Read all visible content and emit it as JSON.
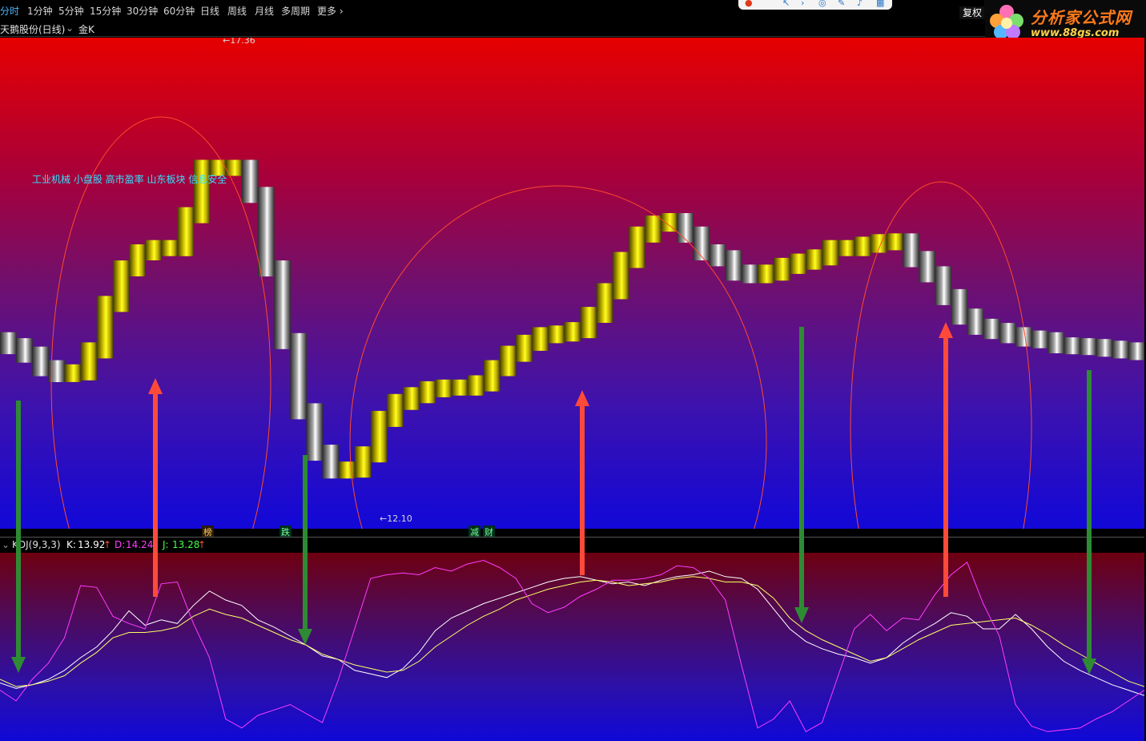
{
  "periods": [
    "分时",
    "1分钟",
    "5分钟",
    "15分钟",
    "30分钟",
    "60分钟",
    "日线",
    "周线",
    "月线",
    "多周期",
    "更多"
  ],
  "fuquan": "复权",
  "logo": {
    "name": "分析家公式网",
    "url": "www.88gs.com"
  },
  "title": {
    "stock": "天鹅股份(日线)",
    "indicator": "金K"
  },
  "tags": "工业机械 小盘股 高市盈率 山东板块 信息安全",
  "price": {
    "high_label": "←17.36",
    "low_label": "←12.10"
  },
  "signals": [
    "榜",
    "跌",
    "减",
    "财"
  ],
  "kdj": {
    "name": "KDJ(9,3,3)",
    "k_label": "K:",
    "k": "13.92",
    "d_label": "D:",
    "d": "14.24",
    "j_label": "J:",
    "j": "13.28"
  },
  "colors": {
    "k": "#ffffff",
    "d": "#ffff66",
    "j": "#ff3cff",
    "up": "#ff4a3a",
    "down": "#2e8b34",
    "circle": "#ff4a2a",
    "candle": "#f2e500"
  },
  "chart_data": [
    {
      "type": "line",
      "x": [
        1,
        2,
        3,
        4,
        5,
        6,
        7,
        8,
        9,
        10,
        11,
        12,
        13,
        14,
        15,
        16,
        17,
        18,
        19,
        20,
        21,
        22,
        23,
        24,
        25,
        26,
        27,
        28,
        29,
        30,
        31,
        32,
        33,
        34,
        35,
        36,
        37,
        38,
        39,
        40,
        41,
        42,
        43,
        44,
        45,
        46,
        47,
        48,
        49,
        50,
        51,
        52,
        53,
        54,
        55,
        56,
        57,
        58,
        59,
        60,
        61,
        62,
        63,
        64,
        65,
        66,
        67,
        68,
        69,
        70,
        71,
        72
      ],
      "series": [
        {
          "name": "price",
          "values": [
            13.78,
            13.71,
            13.61,
            13.45,
            13.38,
            13.4,
            13.66,
            14.21,
            14.63,
            14.82,
            14.87,
            14.87,
            15.26,
            15.82,
            15.82,
            15.82,
            15.5,
            14.63,
            13.77,
            12.94,
            12.45,
            12.24,
            12.25,
            12.43,
            12.85,
            13.05,
            13.13,
            13.2,
            13.22,
            13.22,
            13.27,
            13.45,
            13.62,
            13.75,
            13.84,
            13.86,
            13.9,
            14.08,
            14.36,
            14.73,
            15.03,
            15.16,
            15.19,
            15.03,
            14.82,
            14.75,
            14.58,
            14.55,
            14.58,
            14.66,
            14.71,
            14.76,
            14.87,
            14.87,
            14.91,
            14.94,
            14.95,
            14.74,
            14.56,
            14.29,
            14.06,
            13.94,
            13.89,
            13.84,
            13.8,
            13.78,
            13.72,
            13.71,
            13.7,
            13.68,
            13.66,
            13.64
          ]
        }
      ],
      "ylim": [
        12.1,
        17.36
      ]
    },
    {
      "type": "line",
      "x": [
        1,
        2,
        3,
        4,
        5,
        6,
        7,
        8,
        9,
        10,
        11,
        12,
        13,
        14,
        15,
        16,
        17,
        18,
        19,
        20,
        21,
        22,
        23,
        24,
        25,
        26,
        27,
        28,
        29,
        30,
        31,
        32,
        33,
        34,
        35,
        36,
        37,
        38,
        39,
        40,
        41,
        42,
        43,
        44,
        45,
        46,
        47,
        48,
        49,
        50,
        51,
        52,
        53,
        54,
        55,
        56,
        57,
        58,
        59,
        60,
        61,
        62,
        63,
        64,
        65,
        66,
        67,
        68,
        69,
        70,
        71,
        72
      ],
      "series": [
        {
          "name": "K",
          "values": [
            30,
            27,
            29,
            32,
            37,
            44,
            50,
            59,
            70,
            62,
            65,
            63,
            73,
            81,
            76,
            73,
            65,
            61,
            56,
            51,
            45,
            43,
            37,
            35,
            33,
            38,
            47,
            59,
            66,
            70,
            74,
            77,
            80,
            83,
            86,
            88,
            89,
            87,
            85,
            86,
            84,
            87,
            89,
            90,
            92,
            89,
            88,
            82,
            71,
            60,
            53,
            49,
            46,
            44,
            41,
            44,
            52,
            58,
            63,
            69,
            67,
            60,
            60,
            68,
            60,
            50,
            42,
            37,
            33,
            29,
            26,
            23
          ]
        },
        {
          "name": "D",
          "values": [
            32,
            28,
            29,
            31,
            34,
            41,
            47,
            55,
            58,
            58,
            59,
            61,
            67,
            71,
            68,
            66,
            62,
            58,
            54,
            51,
            46,
            43,
            40,
            38,
            36,
            37,
            42,
            50,
            56,
            62,
            67,
            71,
            76,
            79,
            82,
            84,
            86,
            87,
            86,
            84,
            85,
            86,
            88,
            89,
            88,
            86,
            86,
            84,
            77,
            66,
            59,
            54,
            50,
            46,
            42,
            44,
            49,
            54,
            58,
            62,
            63,
            64,
            65,
            66,
            62,
            57,
            51,
            46,
            41,
            36,
            31,
            28
          ]
        },
        {
          "name": "J",
          "values": [
            26,
            20,
            32,
            41,
            55,
            84,
            83,
            67,
            63,
            60,
            85,
            86,
            63,
            44,
            10,
            5,
            12,
            15,
            18,
            13,
            8,
            32,
            60,
            88,
            90,
            91,
            90,
            94,
            92,
            96,
            98,
            94,
            88,
            74,
            69,
            72,
            78,
            82,
            87,
            87,
            88,
            90,
            95,
            94,
            88,
            76,
            40,
            5,
            10,
            20,
            3,
            8,
            34,
            60,
            68,
            59,
            66,
            65,
            79,
            90,
            97,
            74,
            56,
            18,
            6,
            3,
            4,
            5,
            10,
            14,
            20,
            26
          ]
        }
      ],
      "ylim": [
        0,
        100
      ]
    }
  ]
}
